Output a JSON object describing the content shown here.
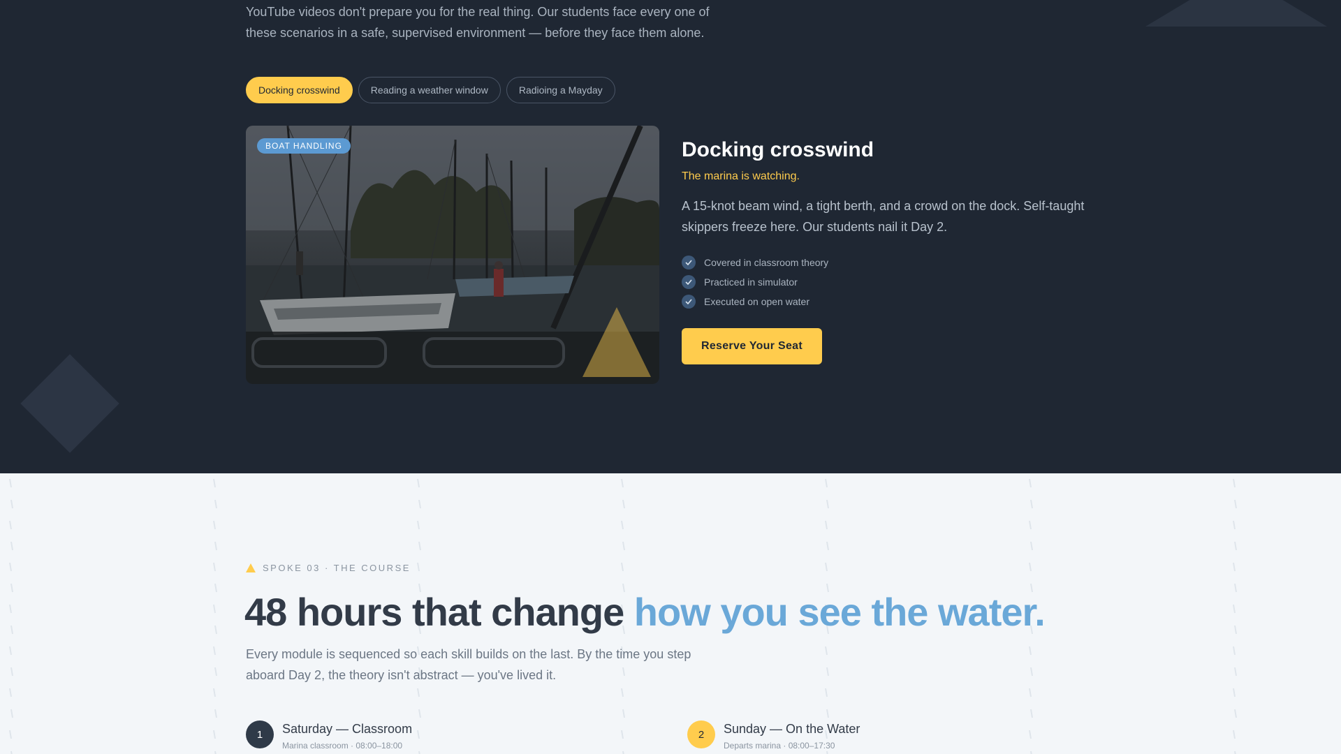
{
  "scenarios": {
    "intro": "YouTube videos don't prepare you for the real thing. Our students face every one of these scenarios in a safe, supervised environment — before they face them alone.",
    "tabs": [
      {
        "label": "Docking crosswind",
        "active": true
      },
      {
        "label": "Reading a weather window",
        "active": false
      },
      {
        "label": "Radioing a Mayday",
        "active": false
      }
    ],
    "active": {
      "badge": "BOAT HANDLING",
      "title": "Docking crosswind",
      "tagline": "The marina is watching.",
      "description": "A 15-knot beam wind, a tight berth, and a crowd on the dock. Self-taught skippers freeze here. Our students nail it Day 2.",
      "checklist": [
        "Covered in classroom theory",
        "Practiced in simulator",
        "Executed on open water"
      ],
      "cta": "Reserve Your Seat"
    }
  },
  "course": {
    "eyebrow": "SPOKE 03 · THE COURSE",
    "headline": "48 hours that change",
    "headline_accent": "how you see the water.",
    "lead": "Every module is sequenced so each skill builds on the last. By the time you step aboard Day 2, the theory isn't abstract — you've lived it.",
    "days": [
      {
        "number": "1",
        "title": "Saturday — Classroom",
        "meta": "Marina classroom · 08:00–18:00"
      },
      {
        "number": "2",
        "title": "Sunday — On the Water",
        "meta": "Departs marina · 08:00–17:30"
      }
    ]
  },
  "colors": {
    "dark_bg": "#1f2733",
    "accent_gold": "#ffcc4d",
    "accent_blue": "#6aa8d8",
    "light_bg": "#f3f6f9"
  },
  "icons": {
    "check": "check-icon",
    "eyebrow": "triangle-icon"
  }
}
